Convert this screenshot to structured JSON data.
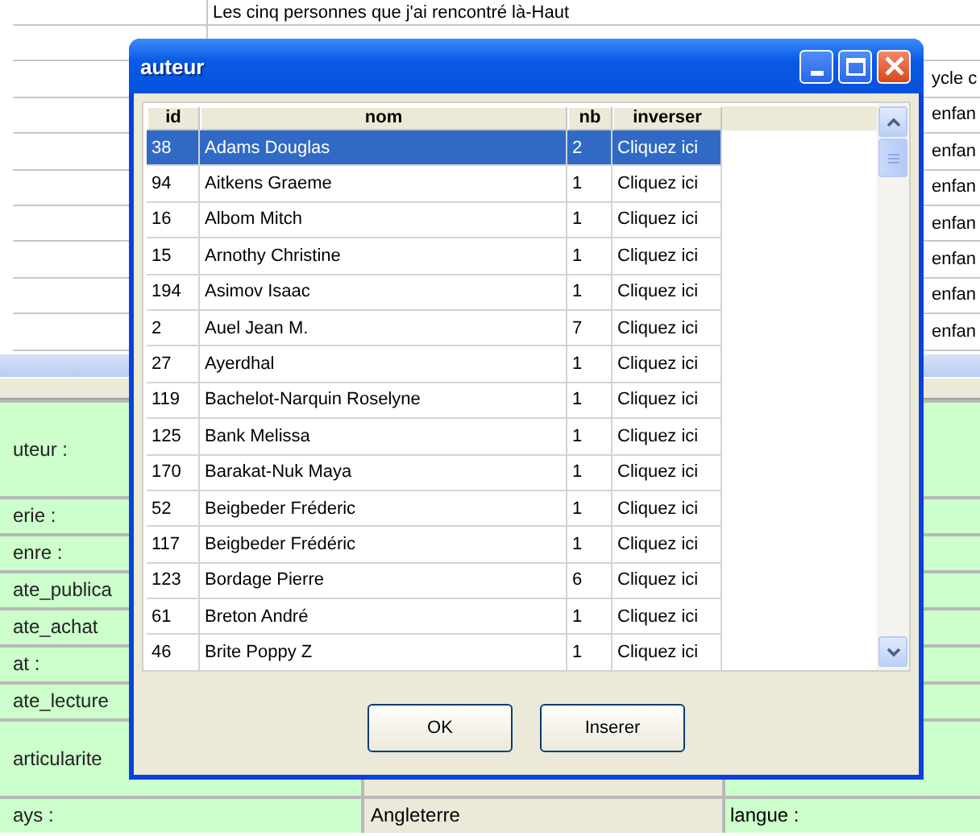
{
  "background_table": {
    "rows": [
      {
        "title": "Les cinq personnes que j'ai rencontré là-Haut"
      },
      {},
      {
        "category": "ycle c"
      },
      {
        "category": "enfan"
      },
      {
        "category": "enfan"
      },
      {
        "category": "enfan"
      },
      {
        "category": "enfan"
      },
      {
        "category": "enfan"
      },
      {
        "category": "enfan"
      },
      {
        "category": "enfan"
      }
    ]
  },
  "form": {
    "rows": [
      {
        "label": "uteur :"
      },
      {
        "label": "erie :"
      },
      {
        "label": "enre :"
      },
      {
        "label": "ate_publica"
      },
      {
        "label": "ate_achat"
      },
      {
        "label": "at :"
      },
      {
        "label": "ate_lecture"
      },
      {
        "label": "articularite"
      },
      {
        "label": "ays :",
        "value": "Angleterre",
        "right_label": "langue :"
      }
    ]
  },
  "dialog": {
    "title": "auteur",
    "columns": [
      "id",
      "nom",
      "nb",
      "inverser"
    ],
    "rows": [
      {
        "id": "38",
        "nom": "Adams Douglas",
        "nb": "2",
        "inverser": "Cliquez ici",
        "selected": true
      },
      {
        "id": "94",
        "nom": "Aitkens Graeme",
        "nb": "1",
        "inverser": "Cliquez ici",
        "selected": false
      },
      {
        "id": "16",
        "nom": "Albom Mitch",
        "nb": "1",
        "inverser": "Cliquez ici",
        "selected": false
      },
      {
        "id": "15",
        "nom": "Arnothy Christine",
        "nb": "1",
        "inverser": "Cliquez ici",
        "selected": false
      },
      {
        "id": "194",
        "nom": "Asimov Isaac",
        "nb": "1",
        "inverser": "Cliquez ici",
        "selected": false
      },
      {
        "id": "2",
        "nom": "Auel Jean M.",
        "nb": "7",
        "inverser": "Cliquez ici",
        "selected": false
      },
      {
        "id": "27",
        "nom": "Ayerdhal",
        "nb": "1",
        "inverser": "Cliquez ici",
        "selected": false
      },
      {
        "id": "119",
        "nom": "Bachelot-Narquin Roselyne",
        "nb": "1",
        "inverser": "Cliquez ici",
        "selected": false
      },
      {
        "id": "125",
        "nom": "Bank Melissa",
        "nb": "1",
        "inverser": "Cliquez ici",
        "selected": false
      },
      {
        "id": "170",
        "nom": "Barakat-Nuk Maya",
        "nb": "1",
        "inverser": "Cliquez ici",
        "selected": false
      },
      {
        "id": "52",
        "nom": "Beigbeder Fréderic",
        "nb": "1",
        "inverser": "Cliquez ici",
        "selected": false
      },
      {
        "id": "117",
        "nom": "Beigbeder Frédéric",
        "nb": "1",
        "inverser": "Cliquez ici",
        "selected": false
      },
      {
        "id": "123",
        "nom": "Bordage Pierre",
        "nb": "6",
        "inverser": "Cliquez ici",
        "selected": false
      },
      {
        "id": "61",
        "nom": "Breton André",
        "nb": "1",
        "inverser": "Cliquez ici",
        "selected": false
      },
      {
        "id": "46",
        "nom": "Brite Poppy Z",
        "nb": "1",
        "inverser": "Cliquez ici",
        "selected": false
      }
    ],
    "buttons": [
      "OK",
      "Inserer"
    ]
  }
}
